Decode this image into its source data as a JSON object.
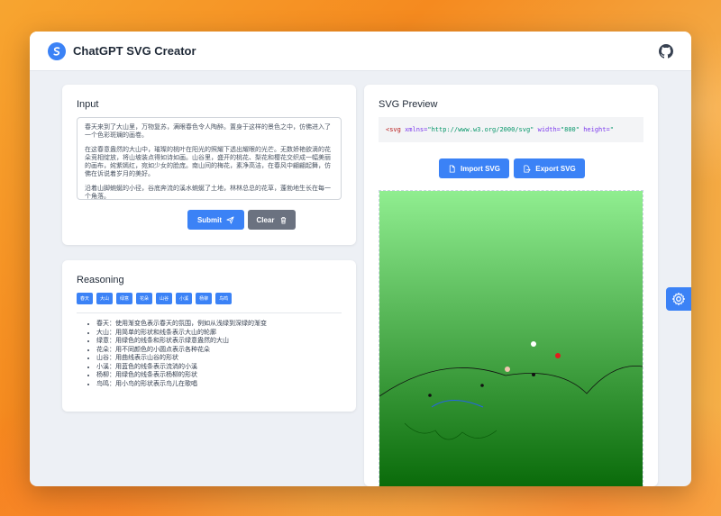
{
  "app": {
    "title": "ChatGPT SVG Creator"
  },
  "input": {
    "title": "Input",
    "paragraphs": [
      "春天来到了大山里，万物复苏，满眼春色令人陶醉。置身于这样的景色之中，仿佛进入了一个色彩斑斓的画卷。",
      "在这春意盎然的大山中，璀璨的桃叶在阳光的照耀下透出耀眼的光芒。无数娇艳欲滴的花朵竞相绽放，将山坡装点得如诗如画。山谷里，盛开的桃花、梨花和樱花交织成一幅美丽的画布，姹紫嫣红，宛如少女的脸庞。南山间的梅花，素净高洁，在春风中翩翩起舞，仿佛在诉说着岁月的美好。",
      "沿着山脚蜿蜒的小径，谷底奔流的溪水蜿蜒了土地，林林总总的花草，蓬勃地生长在每一个角落。"
    ],
    "submit_label": "Submit",
    "clear_label": "Clear"
  },
  "reasoning": {
    "title": "Reasoning",
    "tags": [
      "春天",
      "大山",
      "绿意",
      "花朵",
      "山谷",
      "小溪",
      "杨柳",
      "鸟鸣"
    ],
    "items": [
      "春天：使用渐变色表示春天的氛围，例如从浅绿到深绿的渐变",
      "大山：用简单的形状和线条表示大山的轮廓",
      "绿意：用绿色的线条和形状表示绿意盎然的大山",
      "花朵：用不同颜色的小圆点表示各种花朵",
      "山谷：用曲线表示山谷的形状",
      "小溪：用蓝色的线条表示流淌的小溪",
      "杨柳：用绿色的线条表示杨柳的形状",
      "鸟鸣：用小鸟的形状表示鸟儿在歌唱"
    ]
  },
  "preview": {
    "title": "SVG Preview",
    "code": {
      "open": "<svg",
      "a1": " xmlns=",
      "v1": "\"http://www.w3.org/2000/svg\"",
      "a2": " width=",
      "v2": "\"800\"",
      "a3": " height=",
      "v3": "\""
    },
    "import_label": "Import SVG",
    "export_label": "Export SVG",
    "gradient": {
      "top": "#90ee90",
      "bottom": "#0a6b0a"
    },
    "dots": [
      {
        "name": "white-dot",
        "color": "#ffffff"
      },
      {
        "name": "red-dot",
        "color": "#e11d1d"
      },
      {
        "name": "pink-dot",
        "color": "#f2c6b0"
      },
      {
        "name": "black-dot-1",
        "color": "#111111"
      },
      {
        "name": "black-dot-2",
        "color": "#111111"
      },
      {
        "name": "black-dot-3",
        "color": "#111111"
      }
    ],
    "stream_color": "#2563eb"
  },
  "colors": {
    "accent": "#3b82f6",
    "neutral_button": "#6b7280"
  }
}
